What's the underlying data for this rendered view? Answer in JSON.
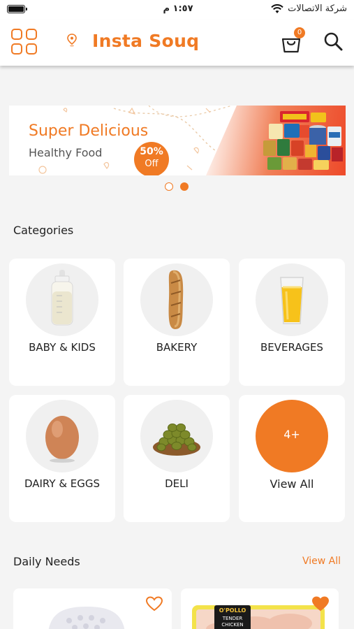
{
  "status_bar": {
    "time": "١:٥٧ م",
    "carrier": "شركة الاتصالات"
  },
  "header": {
    "brand": "Insta Souq",
    "cart_count": "0"
  },
  "banner": {
    "title": "Super Delicious",
    "subtitle": "Healthy Food",
    "discount_percent": "50%",
    "discount_label": "Off",
    "active_slide": 2,
    "slide_count": 2
  },
  "categories": {
    "title": "Categories",
    "items": [
      {
        "label": "BABY & KIDS",
        "icon": "baby-bottle-icon"
      },
      {
        "label": "BAKERY",
        "icon": "bread-icon"
      },
      {
        "label": "BEVERAGES",
        "icon": "juice-glass-icon"
      },
      {
        "label": "DAIRY & EGGS",
        "icon": "egg-icon"
      },
      {
        "label": "DELI",
        "icon": "olives-bowl-icon"
      }
    ],
    "view_all": {
      "badge": "4+",
      "label": "View All"
    }
  },
  "daily_needs": {
    "title": "Daily Needs",
    "view_all": "View All",
    "products": [
      {
        "favorite": false,
        "image": "eggs-tray"
      },
      {
        "favorite": true,
        "image": "chicken-pack",
        "brand_text": "O'POLLO",
        "package_text": "TENDER CHICKEN BREAST"
      }
    ]
  },
  "colors": {
    "accent": "#f07a24",
    "background": "#f4f4f4",
    "card": "#ffffff"
  }
}
